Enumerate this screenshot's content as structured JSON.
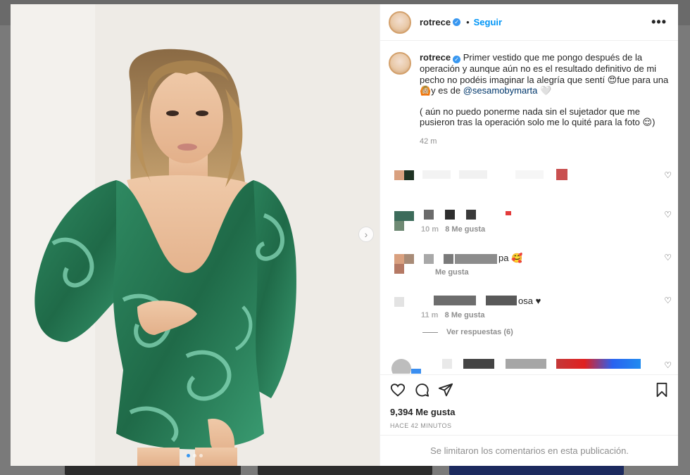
{
  "post": {
    "username": "rotrece",
    "verified_mark": "✓",
    "separator": "•",
    "follow_label": "Seguir",
    "more_label": "•••",
    "caption_part1": "Primer vestido que me pongo después de la operación y aunque aún no es el resultado definitivo de mi pecho no podéis imaginar la alegría que sentí 😍fue para una 🙆🏼y es de ",
    "mention": "@sesamobymarta",
    "caption_part1_end": " 🤍",
    "caption_part2": "( aún no puedo ponerme nada sin el sujetador que me pusieron tras la operación solo me lo quité para la foto 😌)",
    "time": "42 m",
    "likes": "9,394 Me gusta",
    "time_ago": "HACE 42 MINUTOS",
    "comments_disabled": "Se limitaron los comentarios en esta publicación.",
    "next_arrow": "›"
  },
  "comments": [
    {
      "text": "",
      "meta": "",
      "heart": "♡"
    },
    {
      "text": "",
      "meta_time": "10 m",
      "meta_likes": "8 Me gusta",
      "heart": "♡"
    },
    {
      "text": "pa 🥰",
      "meta_likes": "Me gusta",
      "heart": "♡"
    },
    {
      "text": "osa ♥",
      "meta_time": "11 m",
      "meta_likes": "8 Me gusta",
      "heart": "♡"
    },
    {
      "text": "",
      "heart": "♡"
    }
  ],
  "view_replies": "Ver respuestas (6)",
  "icons": [
    "heart-icon",
    "comment-icon",
    "share-icon",
    "save-icon",
    "chevron-right-icon"
  ],
  "colors": {
    "accent": "#0095f6",
    "verified": "#3897f0",
    "dress": "#2f8a62"
  }
}
